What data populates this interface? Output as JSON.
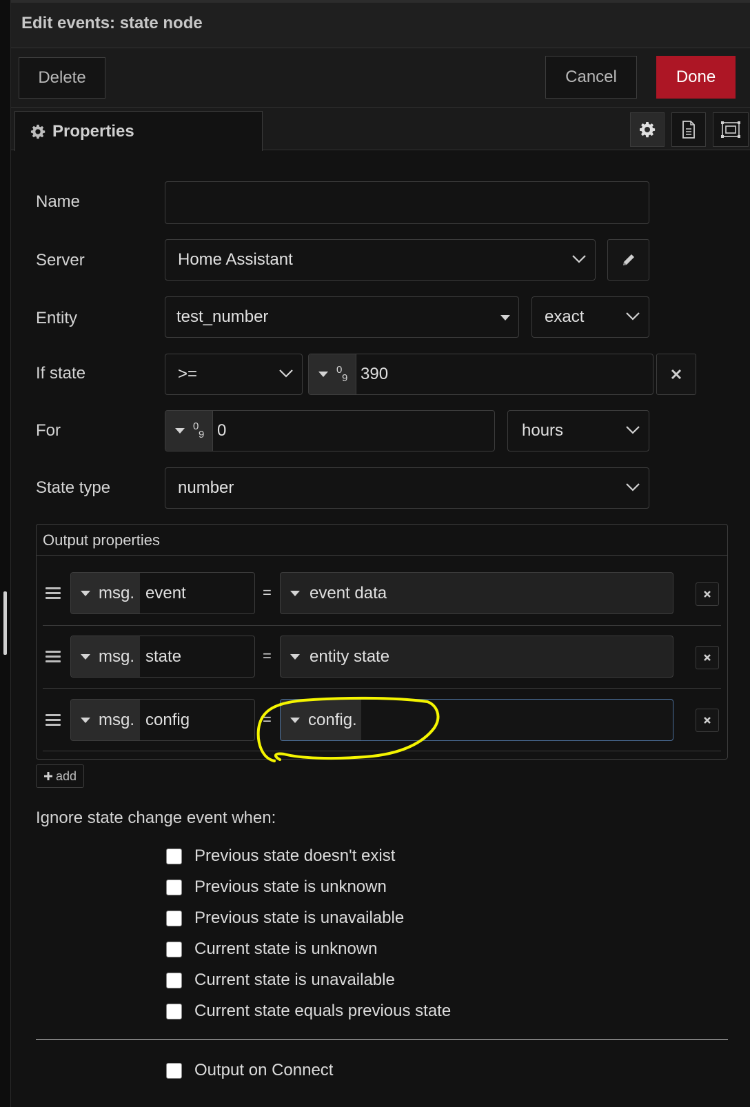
{
  "header": {
    "title": "Edit events: state node"
  },
  "buttons": {
    "delete": "Delete",
    "cancel": "Cancel",
    "done": "Done"
  },
  "tabs": {
    "properties": "Properties"
  },
  "form": {
    "name_label": "Name",
    "name_value": "",
    "server_label": "Server",
    "server_value": "Home Assistant",
    "entity_label": "Entity",
    "entity_value": "test_number",
    "entity_match": "exact",
    "ifstate_label": "If state",
    "ifstate_operator": ">=",
    "ifstate_value": "390",
    "for_label": "For",
    "for_value": "0",
    "for_unit": "hours",
    "statetype_label": "State type",
    "statetype_value": "number",
    "num_icon_top": "0",
    "num_icon_bottom": "9"
  },
  "output": {
    "title": "Output properties",
    "rows": [
      {
        "prefix": "msg.",
        "property": "event",
        "equals": "=",
        "value": "event data"
      },
      {
        "prefix": "msg.",
        "property": "state",
        "equals": "=",
        "value": "entity state"
      },
      {
        "prefix": "msg.",
        "property": "config",
        "equals": "=",
        "value": "config."
      }
    ],
    "add_label": "add"
  },
  "ignore": {
    "heading": "Ignore state change event when:",
    "options": [
      "Previous state doesn't exist",
      "Previous state is unknown",
      "Previous state is unavailable",
      "Current state is unknown",
      "Current state is unavailable",
      "Current state equals previous state"
    ]
  },
  "output_on_connect": "Output on Connect",
  "colors": {
    "done_button": "#ad1625",
    "highlight_annotation": "#f5f500",
    "background": "#121212"
  }
}
